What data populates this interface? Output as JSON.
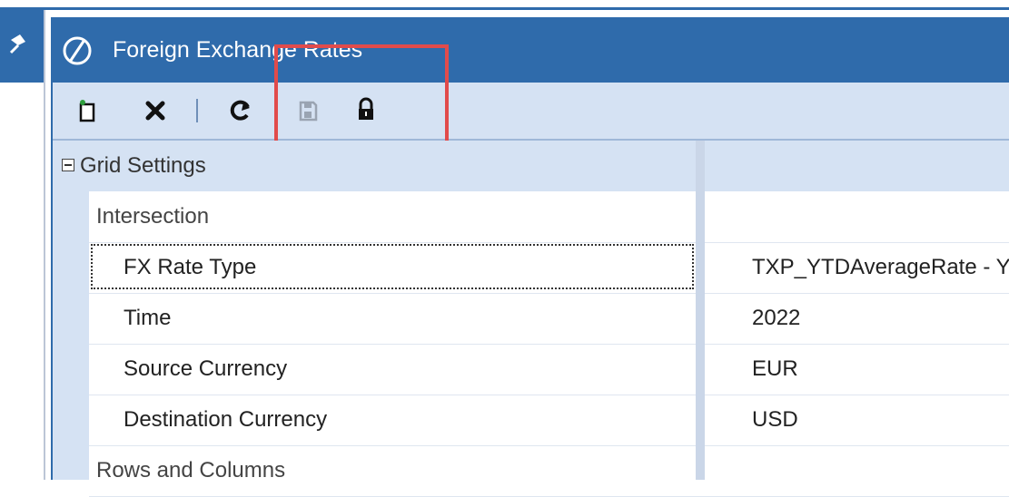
{
  "window": {
    "title": "Foreign Exchange Rates"
  },
  "toolbar": {
    "buttons": [
      {
        "icon": "new-document-icon"
      },
      {
        "icon": "delete-x-icon"
      },
      {
        "icon": "refresh-icon"
      },
      {
        "icon": "save-icon",
        "enabled": false
      },
      {
        "icon": "lock-icon"
      }
    ]
  },
  "grid": {
    "category": "Grid Settings",
    "intersection_label": "Intersection",
    "rows": [
      {
        "name": "FX Rate Type",
        "value": "TXP_YTDAverageRate - Y"
      },
      {
        "name": "Time",
        "value": "2022"
      },
      {
        "name": "Source Currency",
        "value": "EUR"
      },
      {
        "name": "Destination Currency",
        "value": "USD"
      }
    ],
    "rows_and_columns_label": "Rows and Columns"
  },
  "colors": {
    "accent": "#2f6bab",
    "toolbar_bg": "#d5e2f3",
    "highlight": "#e14b4b"
  }
}
